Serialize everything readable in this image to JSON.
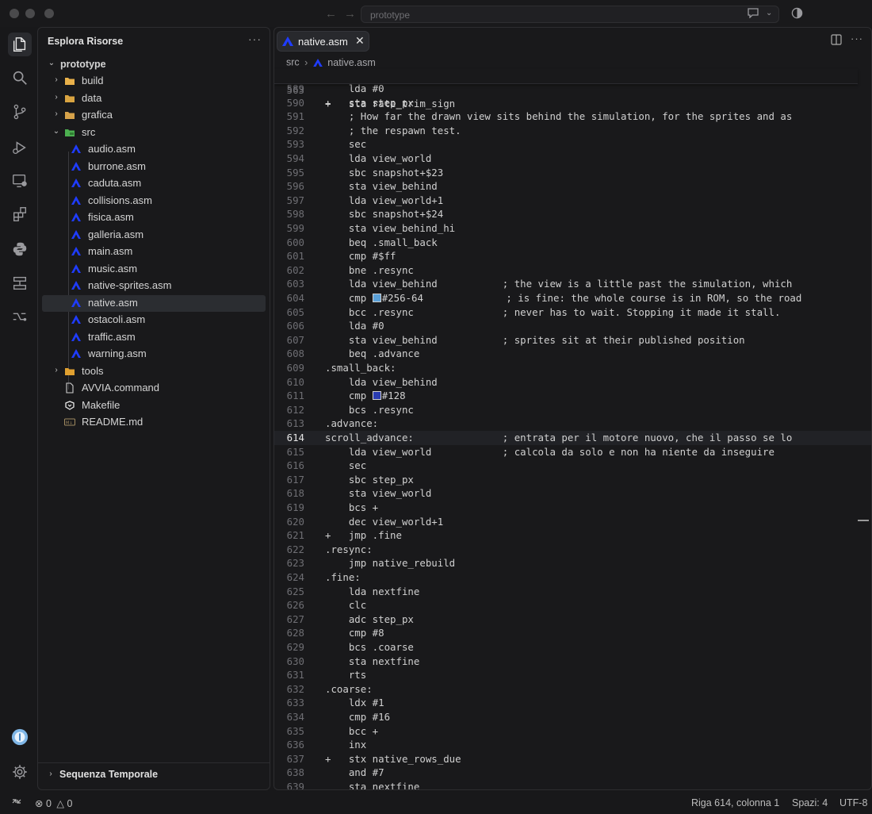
{
  "titlebar": {
    "search_text": "prototype"
  },
  "explorer": {
    "title": "Esplora Risorse",
    "root": "prototype",
    "items": [
      {
        "label": "build",
        "kind": "folder",
        "icon": "folder-build-icon",
        "color": "#e8b04a"
      },
      {
        "label": "data",
        "kind": "folder",
        "icon": "folder-data-icon",
        "color": "#d9a441"
      },
      {
        "label": "grafica",
        "kind": "folder",
        "icon": "folder-icon",
        "color": "#d6a24a"
      },
      {
        "label": "src",
        "kind": "folder-open",
        "icon": "folder-src-icon",
        "color": "#4caf50"
      },
      {
        "label": "audio.asm",
        "kind": "asm"
      },
      {
        "label": "burrone.asm",
        "kind": "asm"
      },
      {
        "label": "caduta.asm",
        "kind": "asm"
      },
      {
        "label": "collisions.asm",
        "kind": "asm"
      },
      {
        "label": "fisica.asm",
        "kind": "asm"
      },
      {
        "label": "galleria.asm",
        "kind": "asm"
      },
      {
        "label": "main.asm",
        "kind": "asm"
      },
      {
        "label": "music.asm",
        "kind": "asm"
      },
      {
        "label": "native-sprites.asm",
        "kind": "asm"
      },
      {
        "label": "native.asm",
        "kind": "asm",
        "selected": true
      },
      {
        "label": "ostacoli.asm",
        "kind": "asm"
      },
      {
        "label": "traffic.asm",
        "kind": "asm"
      },
      {
        "label": "warning.asm",
        "kind": "asm"
      },
      {
        "label": "tools",
        "kind": "folder",
        "icon": "folder-tools-icon",
        "color": "#e0a030"
      },
      {
        "label": "AVVIA.command",
        "kind": "file"
      },
      {
        "label": "Makefile",
        "kind": "makefile"
      },
      {
        "label": "README.md",
        "kind": "markdown"
      }
    ],
    "footer": "Sequenza Temporale"
  },
  "editor": {
    "tab_label": "native.asm",
    "breadcrumb": [
      "src",
      "native.asm"
    ],
    "sticky_line": {
      "n": "563",
      "text": "+   sta rate_trim_sign"
    },
    "lines": [
      {
        "n": "589",
        "text": "    lda #0"
      },
      {
        "n": "590",
        "text": "+   sta step_px"
      },
      {
        "n": "591",
        "text": "    ; How far the drawn view sits behind the simulation, for the sprites and as"
      },
      {
        "n": "592",
        "text": "    ; the respawn test."
      },
      {
        "n": "593",
        "text": "    sec"
      },
      {
        "n": "594",
        "text": "    lda view_world"
      },
      {
        "n": "595",
        "text": "    sbc snapshot+$23"
      },
      {
        "n": "596",
        "text": "    sta view_behind"
      },
      {
        "n": "597",
        "text": "    lda view_world+1"
      },
      {
        "n": "598",
        "text": "    sbc snapshot+$24"
      },
      {
        "n": "599",
        "text": "    sta view_behind_hi"
      },
      {
        "n": "600",
        "text": "    beq .small_back"
      },
      {
        "n": "601",
        "text": "    cmp #$ff"
      },
      {
        "n": "602",
        "text": "    bne .resync"
      },
      {
        "n": "603",
        "text": "    lda view_behind           ; the view is a little past the simulation, which"
      },
      {
        "n": "604",
        "text": "#256-64              ; is fine: the whole course is in ROM, so the road",
        "pre": "    cmp ",
        "swatch": "#5aa0d8"
      },
      {
        "n": "605",
        "text": "    bcc .resync               ; never has to wait. Stopping it made it stall."
      },
      {
        "n": "606",
        "text": "    lda #0"
      },
      {
        "n": "607",
        "text": "    sta view_behind           ; sprites sit at their published position"
      },
      {
        "n": "608",
        "text": "    beq .advance"
      },
      {
        "n": "609",
        "text": ".small_back:"
      },
      {
        "n": "610",
        "text": "    lda view_behind"
      },
      {
        "n": "611",
        "text": "#128",
        "pre": "    cmp ",
        "swatch": "#2a3cb0"
      },
      {
        "n": "612",
        "text": "    bcs .resync"
      },
      {
        "n": "613",
        "text": ".advance:"
      },
      {
        "n": "614",
        "text": "scroll_advance:               ; entrata per il motore nuovo, che il passo se lo",
        "current": true
      },
      {
        "n": "615",
        "text": "    lda view_world            ; calcola da solo e non ha niente da inseguire"
      },
      {
        "n": "616",
        "text": "    sec"
      },
      {
        "n": "617",
        "text": "    sbc step_px"
      },
      {
        "n": "618",
        "text": "    sta view_world"
      },
      {
        "n": "619",
        "text": "    bcs +"
      },
      {
        "n": "620",
        "text": "    dec view_world+1"
      },
      {
        "n": "621",
        "text": "+   jmp .fine"
      },
      {
        "n": "622",
        "text": ".resync:"
      },
      {
        "n": "623",
        "text": "    jmp native_rebuild"
      },
      {
        "n": "624",
        "text": ".fine:"
      },
      {
        "n": "625",
        "text": "    lda nextfine"
      },
      {
        "n": "626",
        "text": "    clc"
      },
      {
        "n": "627",
        "text": "    adc step_px"
      },
      {
        "n": "628",
        "text": "    cmp #8"
      },
      {
        "n": "629",
        "text": "    bcs .coarse"
      },
      {
        "n": "630",
        "text": "    sta nextfine"
      },
      {
        "n": "631",
        "text": "    rts"
      },
      {
        "n": "632",
        "text": ".coarse:"
      },
      {
        "n": "633",
        "text": "    ldx #1"
      },
      {
        "n": "634",
        "text": "    cmp #16"
      },
      {
        "n": "635",
        "text": "    bcc +"
      },
      {
        "n": "636",
        "text": "    inx"
      },
      {
        "n": "637",
        "text": "+   stx native_rows_due"
      },
      {
        "n": "638",
        "text": "    and #7"
      },
      {
        "n": "639",
        "text": "    sta nextfine"
      }
    ]
  },
  "statusbar": {
    "errors": "0",
    "warnings": "0",
    "position": "Riga 614, colonna 1",
    "spaces": "Spazi: 4",
    "encoding": "UTF-8"
  },
  "colors": {
    "asm_icon": "#1f3cff",
    "accent": "#0a84ff"
  }
}
